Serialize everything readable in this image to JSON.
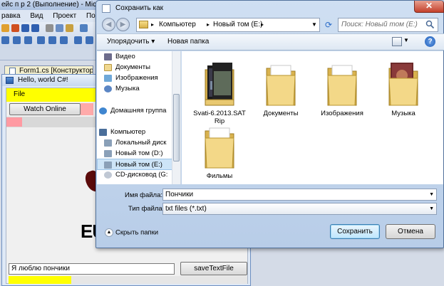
{
  "vs": {
    "title": "ейс п р 2 (Выполнение) - Microso",
    "menu": [
      "равка",
      "Вид",
      "Проект",
      "Построен"
    ],
    "tab_label": "Form1.cs [Конструктор]",
    "tab_close": "⊠"
  },
  "form": {
    "title": "Hello, world C#!",
    "menu_file": "File",
    "watch_button": "Watch Online",
    "big_text": "EU",
    "text_input_value": "Я люблю пончики",
    "save_button": "saveTextFile",
    "accent_color": "#ffff00"
  },
  "dialog": {
    "title": "Сохранить как",
    "close_glyph": "✕",
    "address": {
      "segments": [
        "Компьютер",
        "Новый том (E:)"
      ],
      "separator": "▸"
    },
    "search_placeholder": "Поиск: Новый том (E:)",
    "toolbar": {
      "organize": "Упорядочить ▾",
      "new_folder": "Новая папка"
    },
    "nav": [
      {
        "label": "Видео",
        "icon": "video-library-icon"
      },
      {
        "label": "Документы",
        "icon": "documents-library-icon"
      },
      {
        "label": "Изображения",
        "icon": "pictures-library-icon"
      },
      {
        "label": "Музыка",
        "icon": "music-library-icon"
      },
      {
        "label": "Домашняя группа",
        "icon": "homegroup-icon"
      },
      {
        "label": "Компьютер",
        "icon": "computer-icon"
      },
      {
        "label": "Локальный диск",
        "icon": "local-disk-icon"
      },
      {
        "label": "Новый том (D:)",
        "icon": "drive-icon"
      },
      {
        "label": "Новый том (E:)",
        "icon": "drive-icon"
      },
      {
        "label": "CD-дисковод (G:",
        "icon": "cd-drive-icon"
      }
    ],
    "files": [
      {
        "label": "Svati-6.2013.SAT Rip",
        "icon": "video-folder-icon"
      },
      {
        "label": "Документы",
        "icon": "folder-icon"
      },
      {
        "label": "Изображения",
        "icon": "folder-icon"
      },
      {
        "label": "Музыка",
        "icon": "music-folder-icon"
      },
      {
        "label": "Фильмы",
        "icon": "folder-icon"
      }
    ],
    "filename_label": "Имя файла:",
    "filename_value": "Пончики",
    "filetype_label": "Тип файла:",
    "filetype_value": "txt files (*.txt)",
    "hide_folders": "Скрыть папки",
    "save_button": "Сохранить",
    "cancel_button": "Отмена"
  }
}
